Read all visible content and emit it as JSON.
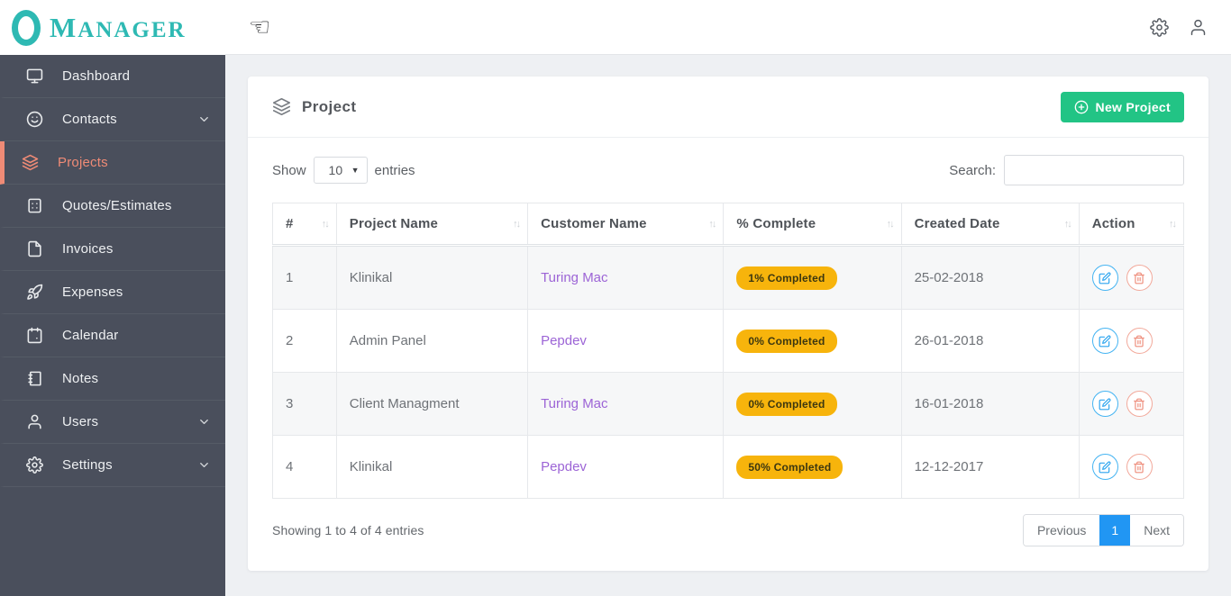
{
  "app_title": "Manager",
  "topbar": {
    "menu_icon": "hand-pointer-left",
    "hand_glyph": "☜",
    "right_icons": [
      "gear-icon",
      "user-icon"
    ]
  },
  "sidebar": {
    "items": [
      {
        "label": "Dashboard",
        "icon": "monitor-icon",
        "active": false,
        "expandable": false
      },
      {
        "label": "Contacts",
        "icon": "smiley-icon",
        "active": false,
        "expandable": true
      },
      {
        "label": "Projects",
        "icon": "layers-icon",
        "active": true,
        "expandable": false
      },
      {
        "label": "Quotes/Estimates",
        "icon": "calculator-icon",
        "active": false,
        "expandable": false
      },
      {
        "label": "Invoices",
        "icon": "file-icon",
        "active": false,
        "expandable": false
      },
      {
        "label": "Expenses",
        "icon": "rocket-icon",
        "active": false,
        "expandable": false
      },
      {
        "label": "Calendar",
        "icon": "calendar-icon",
        "active": false,
        "expandable": false
      },
      {
        "label": "Notes",
        "icon": "notebook-icon",
        "active": false,
        "expandable": false
      },
      {
        "label": "Users",
        "icon": "user-icon",
        "active": false,
        "expandable": true
      },
      {
        "label": "Settings",
        "icon": "gear-icon",
        "active": false,
        "expandable": true
      }
    ]
  },
  "page": {
    "card": {
      "title": "Project",
      "new_button_label": "New Project",
      "controls": {
        "show_label": "Show",
        "page_size": "10",
        "entries_label": "entries",
        "search_label": "Search:",
        "search_value": ""
      },
      "table": {
        "columns": [
          "#",
          "Project Name",
          "Customer Name",
          "% Complete",
          "Created Date",
          "Action"
        ],
        "rows": [
          {
            "num": "1",
            "project": "Klinikal",
            "customer": "Turing Mac",
            "complete": "1% Completed",
            "date": "25-02-2018"
          },
          {
            "num": "2",
            "project": "Admin Panel",
            "customer": "Pepdev",
            "complete": "0% Completed",
            "date": "26-01-2018"
          },
          {
            "num": "3",
            "project": "Client Managment",
            "customer": "Turing Mac",
            "complete": "0% Completed",
            "date": "16-01-2018"
          },
          {
            "num": "4",
            "project": "Klinikal",
            "customer": "Pepdev",
            "complete": "50% Completed",
            "date": "12-12-2017"
          }
        ]
      },
      "footer": {
        "summary": "Showing 1 to 4 of 4 entries",
        "pagination": {
          "previous": "Previous",
          "current_page": "1",
          "next": "Next"
        }
      }
    }
  },
  "colors": {
    "brand_teal": "#2eb9b3",
    "sidebar_bg": "#4a4f5c",
    "active_item_salmon": "#f08b76",
    "new_button_green": "#22c485",
    "badge_amber": "#f7b40c",
    "customer_link_purple": "#9c64d6",
    "pagination_active_blue": "#2196f3",
    "edit_icon_blue": "#2ba4ef",
    "delete_icon_salmon": "#ee8d7b",
    "page_bg": "#eef0f3"
  }
}
